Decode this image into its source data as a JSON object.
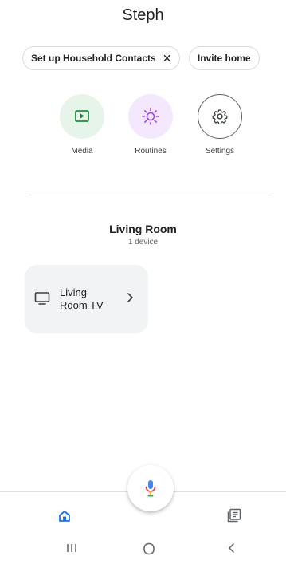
{
  "header": {
    "title": "Steph"
  },
  "chips": [
    {
      "label": "Set up Household Contacts",
      "dismiss": "✕"
    },
    {
      "label": "Invite home"
    }
  ],
  "actions": [
    {
      "label": "Media",
      "icon": "media-play-icon",
      "color": "#1e8e3e"
    },
    {
      "label": "Routines",
      "icon": "routines-sun-icon",
      "color": "#a142f4"
    },
    {
      "label": "Settings",
      "icon": "gear-icon",
      "color": "#3c4043"
    }
  ],
  "room": {
    "name": "Living Room",
    "device_count": "1 device",
    "devices": [
      {
        "label": "Living Room TV",
        "icon": "tv-icon"
      }
    ]
  },
  "assistant": {
    "icon": "mic-icon"
  },
  "bottom_nav": [
    {
      "icon": "home-icon",
      "active": true,
      "color": "#1a73e8"
    },
    {
      "icon": "feed-icon",
      "active": false,
      "color": "#5f6368"
    }
  ],
  "system_nav": [
    {
      "icon": "recents-icon",
      "glyph": "|||"
    },
    {
      "icon": "system-home-icon"
    },
    {
      "icon": "back-icon",
      "glyph": "<"
    }
  ]
}
